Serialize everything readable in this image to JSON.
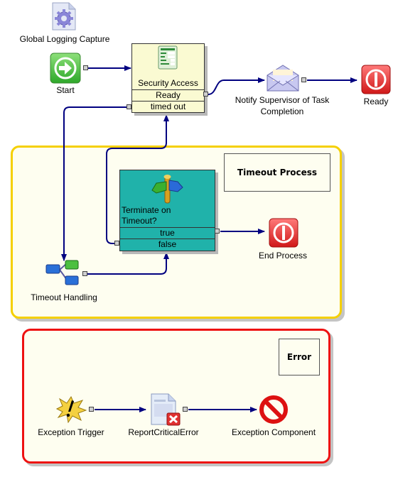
{
  "diagram": {
    "groups": [
      {
        "id": "timeout",
        "title": "Timeout Process",
        "border_color": "#f5d000"
      },
      {
        "id": "error",
        "title": "Error",
        "border_color": "#ee1111"
      }
    ],
    "nodes": {
      "global_logging": {
        "label": "Global Logging Capture",
        "icon": "gear-document-icon"
      },
      "start": {
        "label": "Start",
        "icon": "start-arrow-icon"
      },
      "security_access": {
        "label": "Security Access",
        "icon": "form-document-icon",
        "outcomes": [
          "Ready",
          "timed out"
        ]
      },
      "notify": {
        "label_line1": "Notify Supervisor of Task",
        "label_line2": "Completion",
        "icon": "envelope-icon"
      },
      "ready_end": {
        "label": "Ready",
        "icon": "stop-power-icon"
      },
      "terminate": {
        "label_line1": "Terminate on",
        "label_line2": "Timeout?",
        "icon": "signpost-icon",
        "outcomes": [
          "true",
          "false"
        ]
      },
      "end_process": {
        "label": "End Process",
        "icon": "stop-power-icon"
      },
      "timeout_handling": {
        "label": "Timeout Handling",
        "icon": "tree-branch-icon"
      },
      "exception_trigger": {
        "label": "Exception Trigger",
        "icon": "exclamation-burst-icon"
      },
      "report_error": {
        "label": "ReportCriticalError",
        "icon": "document-error-icon"
      },
      "exception_component": {
        "label": "Exception Component",
        "icon": "prohibited-icon"
      }
    },
    "colors": {
      "wire": "#000080",
      "decision_fill": "#20b2aa",
      "activity_fill": "#fafad2",
      "canvas": "#fefef0"
    }
  }
}
